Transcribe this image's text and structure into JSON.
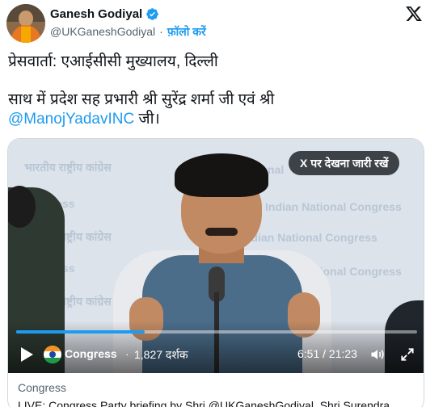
{
  "author": {
    "name": "Ganesh Godiyal",
    "handle": "@UKGaneshGodiyal",
    "dot": "·",
    "follow_label": "फ़ॉलो करें"
  },
  "tweet": {
    "line1": "प्रेसवार्ता: एआईसीसी मुख्यालय, दिल्ली",
    "line2": "साथ में प्रदेश सह प्रभारी श्री सुरेंद्र शर्मा जी एवं श्री",
    "mention": "@ManojYadavINC",
    "line3_suffix": " जी।"
  },
  "video": {
    "watch_on_x_label": "X पर देखना जारी रखें",
    "channel": "Congress",
    "separator": "·",
    "views": "1,827 दर्शक",
    "time": "6:51 / 21:23",
    "progress": 0.32,
    "watermarks": {
      "hindi": "भारतीय राष्ट्रीय कांग्रेस",
      "english": "Indian National Congress",
      "congress": "Congress",
      "national": "National"
    }
  },
  "card": {
    "source": "Congress",
    "title": "LIVE: Congress Party briefing by Shri @UKGaneshGodiyal, Shri Surendra"
  },
  "colors": {
    "accent": "#1d9bf0",
    "text": "#0f1419",
    "secondary": "#536471"
  },
  "icons": [
    "verified-badge-icon",
    "x-logo-icon",
    "play-icon",
    "volume-icon",
    "fullscreen-icon"
  ]
}
